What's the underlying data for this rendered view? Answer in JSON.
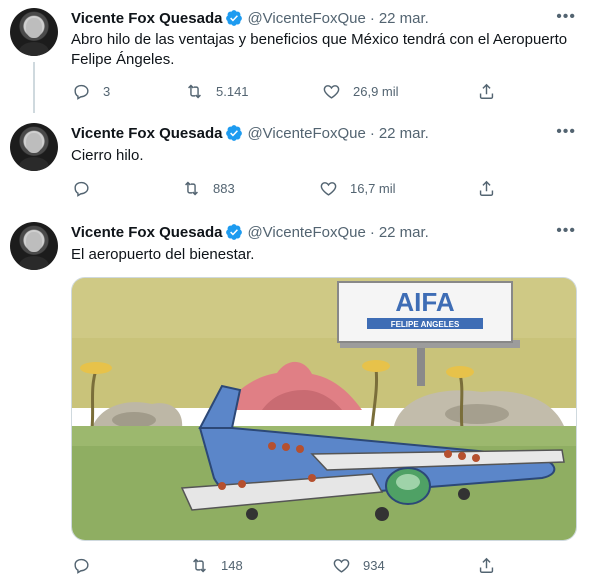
{
  "author": {
    "name": "Vicente Fox Quesada",
    "handle": "@VicenteFoxQue",
    "separator": "·"
  },
  "tweets": [
    {
      "date": "22 mar.",
      "text": "Abro hilo de las ventajas y beneficios que México tendrá con el Aeropuerto Felipe Ángeles.",
      "replies": "3",
      "retweets": "5.141",
      "likes": "26,9 mil"
    },
    {
      "date": "22 mar.",
      "text": "Cierro hilo.",
      "replies": "",
      "retweets": "883",
      "likes": "16,7 mil"
    },
    {
      "date": "22 mar.",
      "text": "El aeropuerto del bienestar.",
      "replies": "",
      "retweets": "148",
      "likes": "934",
      "media": {
        "billboard_title": "AIFA",
        "billboard_subtitle": "FELIPE ANGELES"
      }
    }
  ],
  "icons": {
    "more": "more-horizontal-icon",
    "verified": "verified-badge-icon",
    "reply": "reply-icon",
    "retweet": "retweet-icon",
    "like": "like-icon",
    "share": "share-icon"
  },
  "colors": {
    "verified": "#1d9bf0",
    "secondary_text": "#536471",
    "primary_text": "#0f1419",
    "separator": "#eff3f4"
  }
}
